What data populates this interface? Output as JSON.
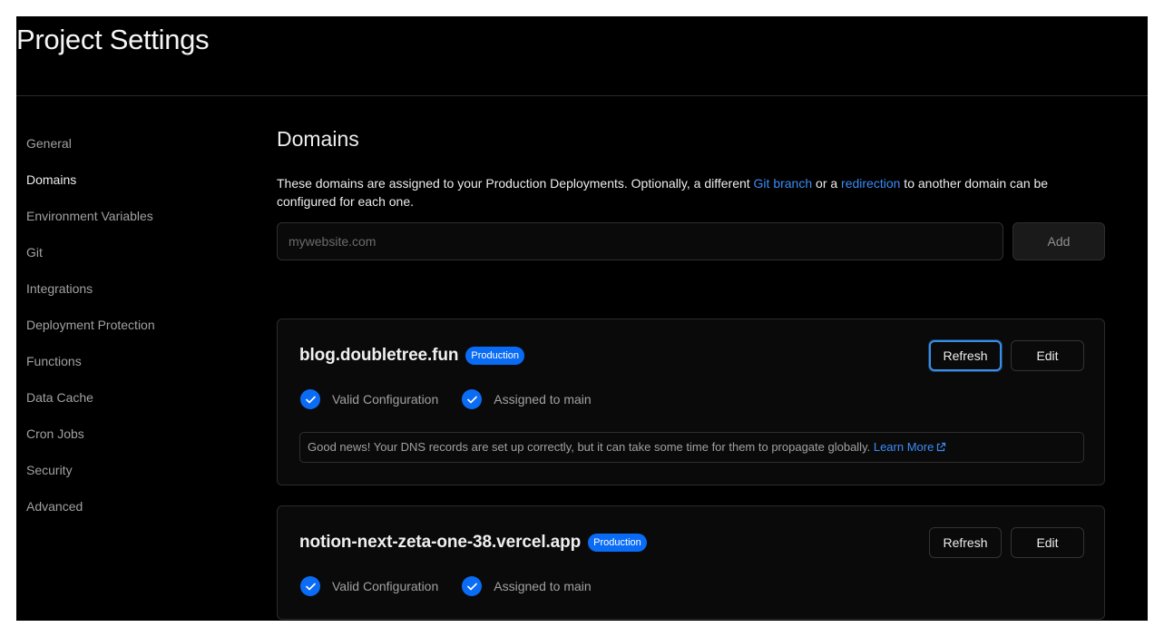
{
  "page": {
    "title": "Project Settings"
  },
  "sidebar": {
    "items": [
      {
        "label": "General",
        "active": false
      },
      {
        "label": "Domains",
        "active": true
      },
      {
        "label": "Environment Variables",
        "active": false
      },
      {
        "label": "Git",
        "active": false
      },
      {
        "label": "Integrations",
        "active": false
      },
      {
        "label": "Deployment Protection",
        "active": false
      },
      {
        "label": "Functions",
        "active": false
      },
      {
        "label": "Data Cache",
        "active": false
      },
      {
        "label": "Cron Jobs",
        "active": false
      },
      {
        "label": "Security",
        "active": false
      },
      {
        "label": "Advanced",
        "active": false
      }
    ]
  },
  "domains": {
    "title": "Domains",
    "description_before": "These domains are assigned to your Production Deployments. Optionally, a different ",
    "link_git_branch": "Git branch",
    "description_middle": " or a ",
    "link_redirection": "redirection",
    "description_after": " to another domain can be configured for each one.",
    "input_placeholder": "mywebsite.com",
    "input_value": "",
    "add_label": "Add",
    "cards": [
      {
        "name": "blog.doubletree.fun",
        "badge": "Production",
        "refresh_label": "Refresh",
        "edit_label": "Edit",
        "status_config": "Valid Configuration",
        "status_assigned": "Assigned to main",
        "info_text": "Good news! Your DNS records are set up correctly, but it can take some time for them to propagate globally. ",
        "info_link": "Learn More"
      },
      {
        "name": "notion-next-zeta-one-38.vercel.app",
        "badge": "Production",
        "refresh_label": "Refresh",
        "edit_label": "Edit",
        "status_config": "Valid Configuration",
        "status_assigned": "Assigned to main"
      }
    ]
  },
  "colors": {
    "background": "#000000",
    "accent": "#0a6cf5",
    "link": "#3b8cf7"
  },
  "icons": {
    "check": "check-circle-icon",
    "external": "external-link-icon"
  }
}
